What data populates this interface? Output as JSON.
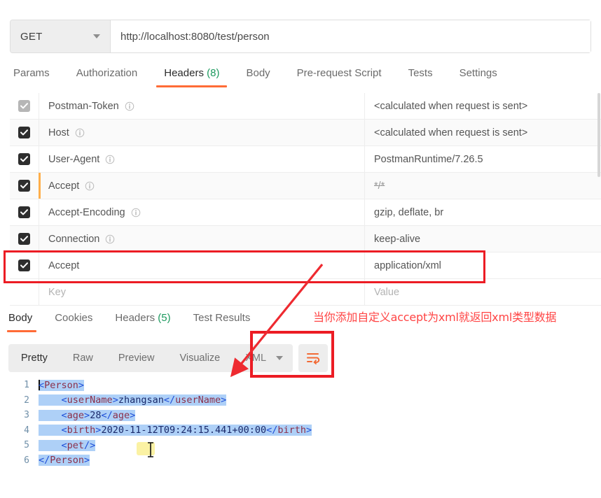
{
  "request": {
    "method": "GET",
    "url": "http://localhost:8080/test/person",
    "tabs": [
      {
        "label": "Params",
        "active": false
      },
      {
        "label": "Authorization",
        "active": false
      },
      {
        "label": "Headers",
        "count": "(8)",
        "active": true
      },
      {
        "label": "Body",
        "active": false
      },
      {
        "label": "Pre-request Script",
        "active": false
      },
      {
        "label": "Tests",
        "active": false
      },
      {
        "label": "Settings",
        "active": false
      }
    ]
  },
  "headers_table": {
    "placeholder_key": "Key",
    "placeholder_value": "Value",
    "rows": [
      {
        "checked": true,
        "dim": true,
        "key": "Postman-Token",
        "info": true,
        "value": "<calculated when request is sent>",
        "strike": false,
        "alt": false,
        "accent": false
      },
      {
        "checked": true,
        "dim": false,
        "key": "Host",
        "info": true,
        "value": "<calculated when request is sent>",
        "strike": false,
        "alt": true,
        "accent": false
      },
      {
        "checked": true,
        "dim": false,
        "key": "User-Agent",
        "info": true,
        "value": "PostmanRuntime/7.26.5",
        "strike": false,
        "alt": false,
        "accent": false
      },
      {
        "checked": true,
        "dim": false,
        "key": "Accept",
        "info": true,
        "value": "*/*",
        "strike": true,
        "alt": true,
        "accent": true
      },
      {
        "checked": true,
        "dim": false,
        "key": "Accept-Encoding",
        "info": true,
        "value": "gzip, deflate, br",
        "strike": false,
        "alt": false,
        "accent": false
      },
      {
        "checked": true,
        "dim": false,
        "key": "Connection",
        "info": true,
        "value": "keep-alive",
        "strike": false,
        "alt": true,
        "accent": false
      },
      {
        "checked": true,
        "dim": false,
        "key": "Accept",
        "info": false,
        "value": "application/xml",
        "strike": false,
        "alt": false,
        "accent": false
      }
    ]
  },
  "response": {
    "tabs": [
      {
        "label": "Body",
        "active": true
      },
      {
        "label": "Cookies",
        "active": false
      },
      {
        "label": "Headers",
        "count": "(5)",
        "active": false
      },
      {
        "label": "Test Results",
        "active": false
      }
    ],
    "format_tabs": [
      {
        "label": "Pretty",
        "active": true
      },
      {
        "label": "Raw",
        "active": false
      },
      {
        "label": "Preview",
        "active": false
      },
      {
        "label": "Visualize",
        "active": false
      }
    ],
    "language": "XML",
    "wrap_icon": "word-wrap-icon"
  },
  "code": {
    "lines": [
      {
        "num": "1",
        "text": "<Person>"
      },
      {
        "num": "2",
        "text": "    <userName>zhangsan</userName>"
      },
      {
        "num": "3",
        "text": "    <age>28</age>"
      },
      {
        "num": "4",
        "text": "    <birth>2020-11-12T09:24:15.441+00:00</birth>"
      },
      {
        "num": "5",
        "text": "    <pet/>"
      },
      {
        "num": "6",
        "text": "</Person>"
      }
    ]
  },
  "annotation": {
    "note": "当你添加自定义accept为xml就返回xml类型数据",
    "color": "#ff4444",
    "box_color": "#ec1c24"
  },
  "colors": {
    "accent_orange": "#ff6c37",
    "green_count": "#1d9a5f",
    "selection_blue": "#aed0f7",
    "checkbox_dark": "#2e2e2e"
  }
}
